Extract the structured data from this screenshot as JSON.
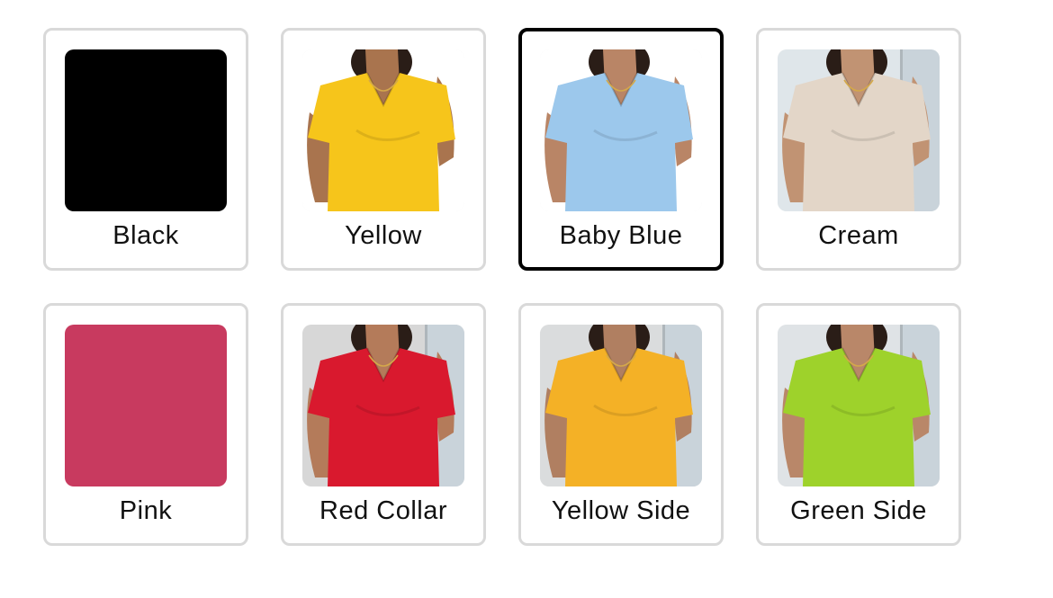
{
  "color_options": [
    {
      "label": "Black",
      "kind": "solid",
      "color": "#000000",
      "selected": false
    },
    {
      "label": "Yellow",
      "kind": "photo",
      "shirt_color": "#f6c51b",
      "bg_color": "#ffffff",
      "skin_color": "#a9744e",
      "selected": false
    },
    {
      "label": "Baby Blue",
      "kind": "photo",
      "shirt_color": "#9cc8ec",
      "bg_color": "#ffffff",
      "skin_color": "#b98566",
      "selected": true
    },
    {
      "label": "Cream",
      "kind": "photo",
      "shirt_color": "#e3d6c8",
      "bg_color": "#dfe6ea",
      "skin_color": "#c19373",
      "selected": false
    },
    {
      "label": "Pink",
      "kind": "solid",
      "color": "#c83a5f",
      "selected": false
    },
    {
      "label": "Red Collar",
      "kind": "photo",
      "shirt_color": "#d9192e",
      "bg_color": "#d7d7d7",
      "skin_color": "#b47b5a",
      "selected": false
    },
    {
      "label": "Yellow Side",
      "kind": "photo",
      "shirt_color": "#f4b126",
      "bg_color": "#dadcdd",
      "skin_color": "#b07f61",
      "selected": false
    },
    {
      "label": "Green Side",
      "kind": "photo",
      "shirt_color": "#9ed22b",
      "bg_color": "#dfe3e6",
      "skin_color": "#b98769",
      "selected": false
    }
  ],
  "selected_border_color": "#000000",
  "default_border_color": "#d9d9d9"
}
